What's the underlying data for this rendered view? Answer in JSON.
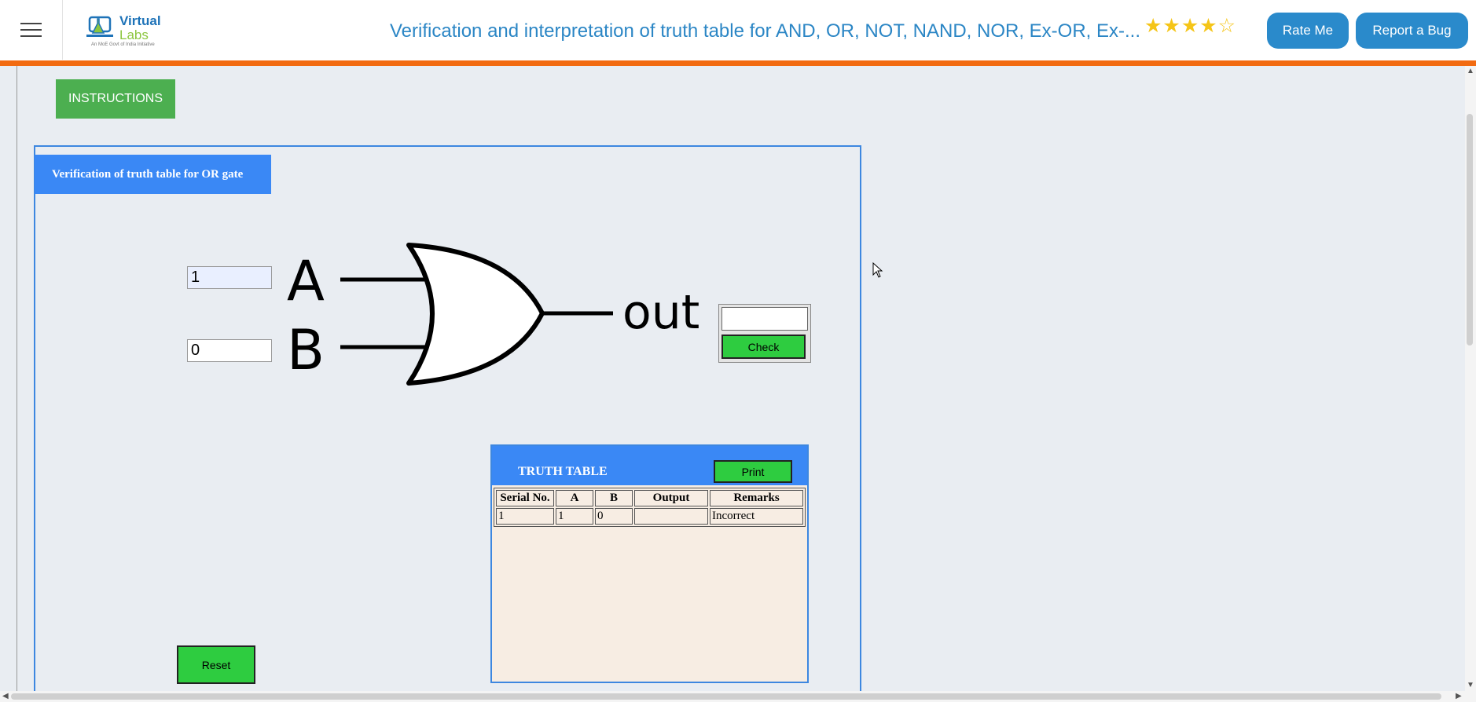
{
  "header": {
    "menu_icon": "hamburger-icon",
    "logo": {
      "line1": "Virtual",
      "line2": "Labs",
      "tagline": "An MoE Govt of India Initiative"
    },
    "title": "Verification and interpretation of truth table for AND, OR, NOT, NAND, NOR, Ex-OR, Ex-...",
    "rating": {
      "value": 4,
      "max": 5,
      "stars": "★★★★☆"
    },
    "rate_label": "Rate Me",
    "bug_label": "Report a Bug",
    "accent_color": "#f26b11",
    "button_color": "#2a8acb"
  },
  "instructions_label": "INSTRUCTIONS",
  "experiment": {
    "title": "Verification of truth table for OR gate",
    "input_a": "1",
    "input_b": "0",
    "label_a": "A",
    "label_b": "B",
    "label_out": "out",
    "output_value": "",
    "check_label": "Check",
    "reset_label": "Reset"
  },
  "truth_table": {
    "title": "TRUTH TABLE",
    "print_label": "Print",
    "columns": [
      "Serial No.",
      "A",
      "B",
      "Output",
      "Remarks"
    ],
    "rows": [
      [
        "1",
        "1",
        "0",
        "",
        "Incorrect"
      ]
    ]
  }
}
